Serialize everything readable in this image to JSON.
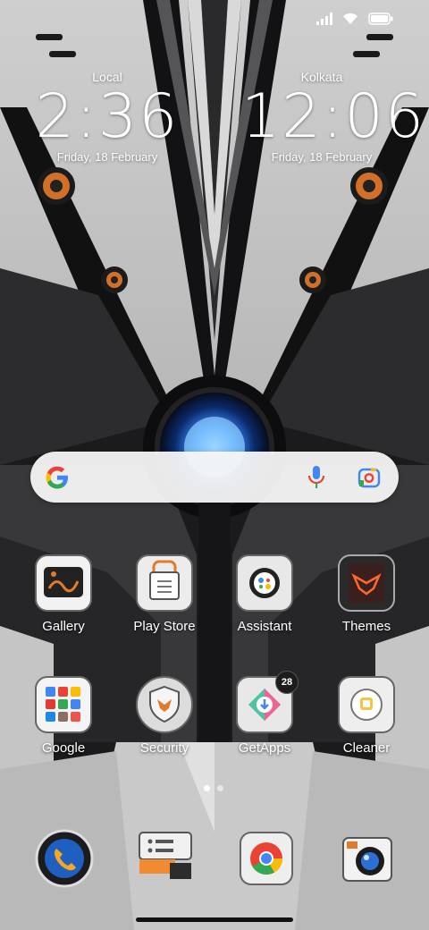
{
  "status_bar": {
    "icons": [
      "signal-icon",
      "wifi-icon",
      "battery-icon"
    ]
  },
  "clocks": [
    {
      "city": "Local",
      "time": "2:36",
      "date": "Friday, 18 February"
    },
    {
      "city": "Kolkata",
      "time": "12:06",
      "date": "Friday, 18 February"
    }
  ],
  "search": {
    "icons": [
      "google-logo-icon",
      "microphone-icon",
      "camera-lens-icon"
    ]
  },
  "apps": [
    {
      "label": "Gallery",
      "icon": "gallery-icon"
    },
    {
      "label": "Play Store",
      "icon": "play-store-icon"
    },
    {
      "label": "Assistant",
      "icon": "assistant-icon"
    },
    {
      "label": "Themes",
      "icon": "themes-icon"
    },
    {
      "label": "Google",
      "icon": "google-folder-icon"
    },
    {
      "label": "Security",
      "icon": "security-icon"
    },
    {
      "label": "GetApps",
      "icon": "getapps-icon",
      "badge": "28"
    },
    {
      "label": "Cleaner",
      "icon": "cleaner-icon"
    }
  ],
  "page_indicator": {
    "pages": 2,
    "current": 1
  },
  "dock": [
    "phone-icon",
    "messages-icon",
    "chrome-icon",
    "camera-icon"
  ],
  "colors": {
    "accent_orange": "#e07b2b",
    "glow_blue": "#2a7fff",
    "panel_dark": "#2b2b2d",
    "panel_light": "#c9c9c9"
  }
}
